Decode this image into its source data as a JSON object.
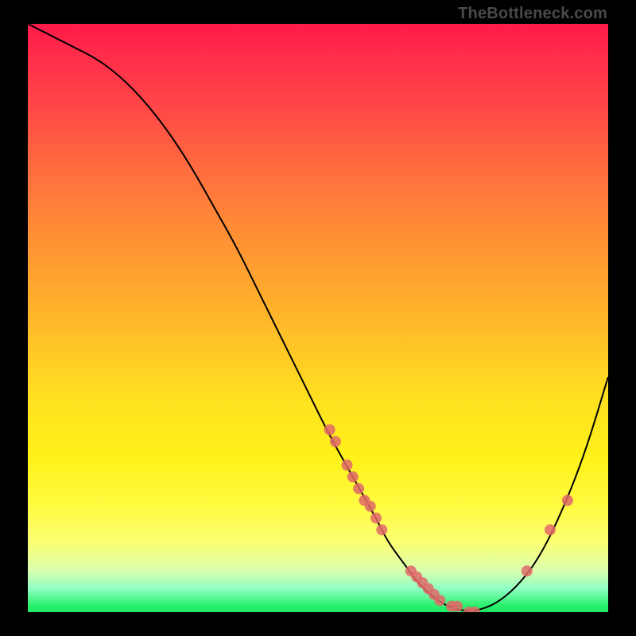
{
  "watermark": "TheBottleneck.com",
  "chart_data": {
    "type": "line",
    "title": "",
    "xlabel": "",
    "ylabel": "",
    "xlim": [
      0,
      100
    ],
    "ylim": [
      0,
      100
    ],
    "legend": false,
    "grid": false,
    "annotations": [],
    "series": [
      {
        "name": "curve",
        "x": [
          0,
          4,
          8,
          12,
          16,
          20,
          24,
          28,
          32,
          36,
          40,
          44,
          48,
          52,
          56,
          60,
          62,
          65,
          68,
          72,
          76,
          80,
          84,
          88,
          92,
          96,
          100
        ],
        "values": [
          100,
          98,
          96,
          94,
          91,
          87,
          82,
          76,
          69,
          62,
          54,
          46,
          38,
          30,
          23,
          16,
          12,
          8,
          4,
          1,
          0,
          1,
          4,
          9,
          17,
          27,
          40
        ]
      },
      {
        "name": "markers",
        "x": [
          52,
          53,
          55,
          56,
          57,
          58,
          59,
          60,
          61,
          66,
          67,
          68,
          69,
          70,
          71,
          73,
          74,
          76,
          77,
          86,
          90,
          93
        ],
        "values": [
          31,
          29,
          25,
          23,
          21,
          19,
          18,
          16,
          14,
          7,
          6,
          5,
          4,
          3,
          2,
          1,
          1,
          0,
          0,
          7,
          14,
          19
        ]
      }
    ]
  }
}
